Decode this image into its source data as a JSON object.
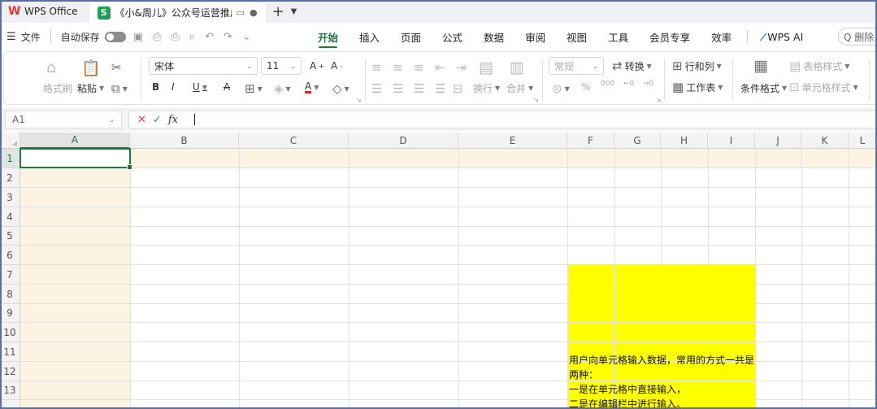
{
  "titlebar": {
    "app_name": "WPS Office",
    "doc_tab_title": "《小&周儿》公众号运营推广",
    "new_tab": "+"
  },
  "menubar": {
    "file_label": "文件",
    "autosave_label": "自动保存",
    "tabs": [
      "开始",
      "插入",
      "页面",
      "公式",
      "数据",
      "审阅",
      "视图",
      "工具",
      "会员专享",
      "效率"
    ],
    "active_tab": "开始",
    "wps_ai_label": "WPS AI",
    "search_placeholder": "Q 删除"
  },
  "ribbon": {
    "format_painter": "格式刷",
    "paste": "粘贴",
    "font_name": "宋体",
    "font_size": "11",
    "number_format": "常规",
    "convert": "转换",
    "rows_cols": "行和列",
    "worksheet": "工作表",
    "conditional_format": "条件格式",
    "table_style": "表格样式",
    "cell_style": "单元格样式",
    "wrap": "换行",
    "merge": "合并",
    "percent": "%",
    "thousands": "000"
  },
  "formula_bar": {
    "name_box": "A1"
  },
  "grid": {
    "columns": [
      "A",
      "B",
      "C",
      "D",
      "E",
      "F",
      "G",
      "H",
      "I",
      "J",
      "K",
      "L"
    ],
    "rows": [
      "1",
      "2",
      "3",
      "4",
      "5",
      "6",
      "7",
      "8",
      "9",
      "10",
      "11",
      "12",
      "13"
    ],
    "selected_cell": "A1",
    "cell_F7_text": "用户向单元格输入数据，常用的方式一共是两种：\n一是在单元格中直接输入，\n二是在编辑栏中进行输入。",
    "cell_F7_fill": "#ffff00"
  }
}
